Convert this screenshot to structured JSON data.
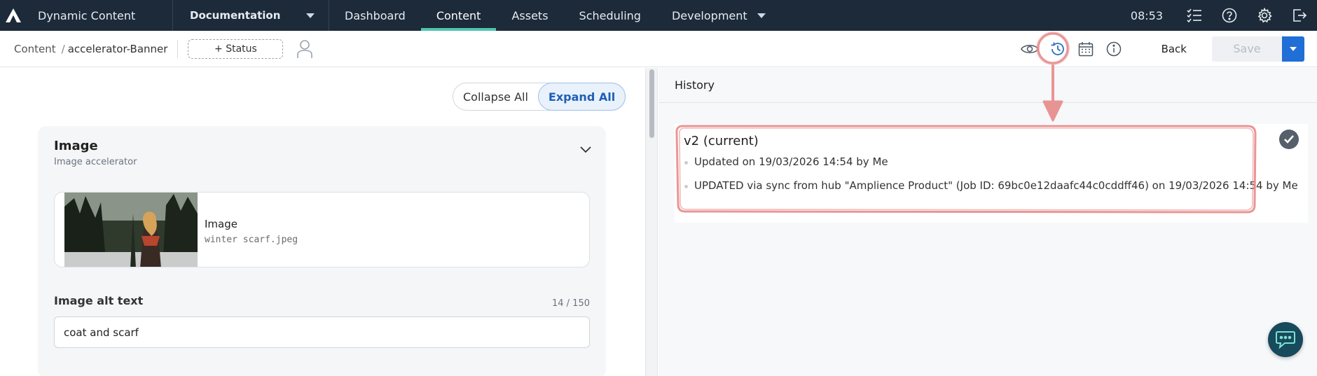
{
  "app": {
    "title": "Dynamic Content"
  },
  "hub": {
    "label": "Documentation"
  },
  "nav": {
    "tabs": [
      {
        "label": "Dashboard"
      },
      {
        "label": "Content",
        "active": true
      },
      {
        "label": "Assets"
      },
      {
        "label": "Scheduling"
      },
      {
        "label": "Development"
      }
    ],
    "time": "08:53",
    "icons": [
      "task-list-icon",
      "help-icon",
      "settings-icon",
      "logout-icon"
    ]
  },
  "breadcrumb": {
    "root": "Content",
    "separator": "/",
    "current": "accelerator-Banner"
  },
  "toolbar": {
    "status_label": "+ Status",
    "back_label": "Back",
    "save_label": "Save",
    "icons": [
      "preview-eye-icon",
      "history-icon",
      "calendar-icon",
      "info-icon"
    ]
  },
  "editor": {
    "collapse_label": "Collapse All",
    "expand_label": "Expand All",
    "section": {
      "title": "Image",
      "subtitle": "Image accelerator",
      "image_label": "Image",
      "image_file": "winter scarf.jpeg",
      "alt_label": "Image alt text",
      "alt_count": "14 / 150",
      "alt_value": "coat and scarf"
    }
  },
  "history": {
    "header": "History",
    "version_title": "v2 (current)",
    "entries": [
      "Updated on 19/03/2026 14:54 by Me",
      "UPDATED via sync from hub \"Amplience Product\" (Job ID: 69bc0e12daafc44c0cddff46) on 19/03/2026 14:54 by Me"
    ]
  },
  "colors": {
    "nav_bg": "#1c2a3a",
    "active_tab_underline": "#4fc3b0",
    "save_dropdown": "#1f6fd6",
    "annotation": "#e88a8a",
    "chat_button": "#164a5c"
  }
}
